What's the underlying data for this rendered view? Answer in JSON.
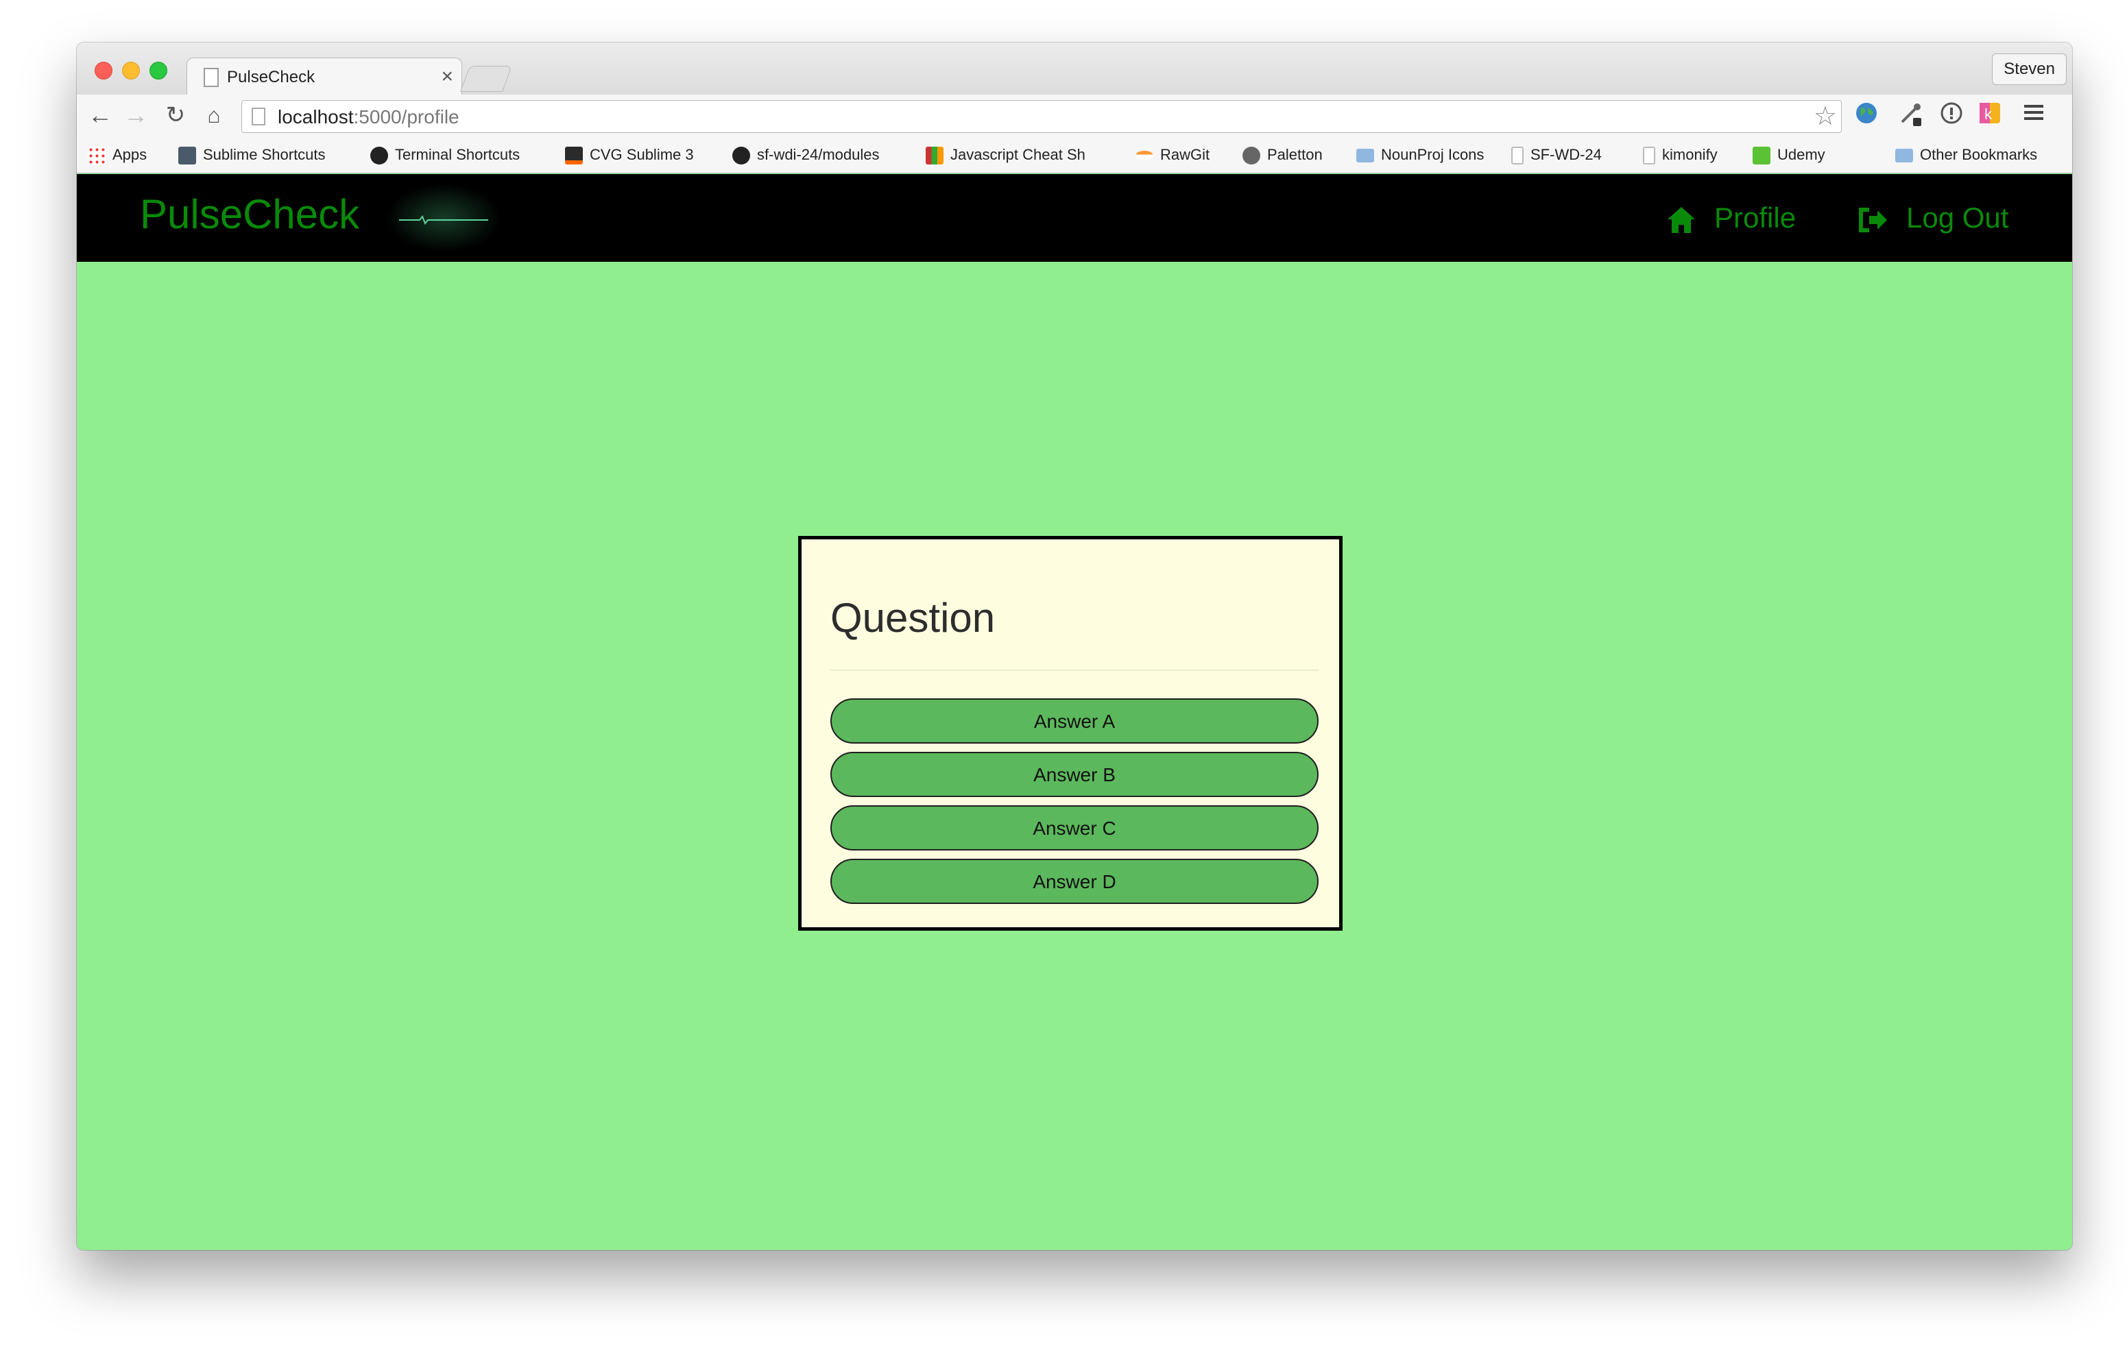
{
  "browser": {
    "tab_title": "PulseCheck",
    "tab_close": "×",
    "profile_name": "Steven",
    "url_host": "localhost",
    "url_path": ":5000/profile",
    "bookmarks": [
      {
        "label": "Apps",
        "icon": "apps-grid-icon"
      },
      {
        "label": "Sublime Shortcuts",
        "icon": "sublime-icon"
      },
      {
        "label": "Terminal Shortcuts",
        "icon": "github-icon"
      },
      {
        "label": "CVG Sublime 3",
        "icon": "cvg-icon"
      },
      {
        "label": "sf-wdi-24/modules",
        "icon": "github-icon"
      },
      {
        "label": "Javascript Cheat Sh",
        "icon": "js-cheatsheet-icon"
      },
      {
        "label": "RawGit",
        "icon": "rawgit-icon"
      },
      {
        "label": "Paletton",
        "icon": "paletton-icon"
      },
      {
        "label": "NounProj Icons",
        "icon": "folder-icon"
      },
      {
        "label": "SF-WD-24",
        "icon": "page-icon"
      },
      {
        "label": "kimonify",
        "icon": "page-icon"
      },
      {
        "label": "Udemy",
        "icon": "udemy-icon"
      },
      {
        "label": "Other Bookmarks",
        "icon": "folder-icon"
      }
    ]
  },
  "navbar": {
    "brand": "PulseCheck",
    "links": [
      {
        "label": "Profile",
        "icon": "home-icon"
      },
      {
        "label": "Log Out",
        "icon": "logout-icon"
      }
    ]
  },
  "card": {
    "question": "Question",
    "answers": [
      "Answer A",
      "Answer B",
      "Answer C",
      "Answer D"
    ]
  },
  "colors": {
    "page_bg": "#90ee8f",
    "navbar_bg": "#000000",
    "brand_green": "#0a8a0a",
    "card_bg": "#fffde0",
    "answer_btn": "#5cb85c"
  }
}
